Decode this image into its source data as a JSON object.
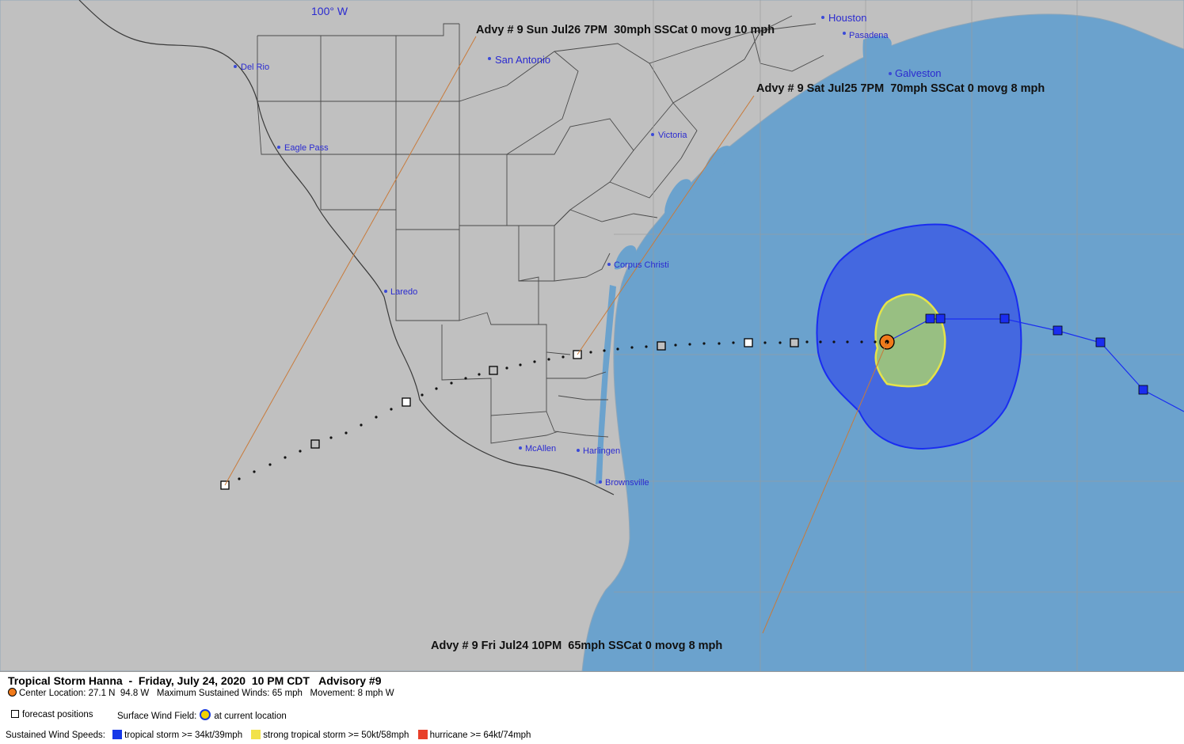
{
  "map": {
    "longitude_label": "100° W",
    "cities": [
      {
        "name": "Houston"
      },
      {
        "name": "Pasadena"
      },
      {
        "name": "San Antonio"
      },
      {
        "name": "Del Rio"
      },
      {
        "name": "Galveston"
      },
      {
        "name": "Eagle Pass"
      },
      {
        "name": "Victoria"
      },
      {
        "name": "Corpus Christi"
      },
      {
        "name": "Laredo"
      },
      {
        "name": "McAllen"
      },
      {
        "name": "Harlingen"
      },
      {
        "name": "Brownsville"
      }
    ],
    "advisory_labels": [
      {
        "text": "Advy # 9 Sun Jul26 7PM  30mph SSCat 0 movg 10 mph"
      },
      {
        "text": "Advy # 9 Sat Jul25 7PM  70mph SSCat 0 movg 8 mph"
      },
      {
        "text": "Advy # 9 Fri Jul24 10PM  65mph SSCat 0 movg 8 mph"
      }
    ]
  },
  "legend": {
    "title": "Tropical Storm Hanna  -  Friday, July 24, 2020  10 PM CDT   Advisory #9",
    "center_info": "Center Location: 27.1 N  94.8 W   Maximum Sustained Winds: 65 mph   Movement: 8 mph W",
    "forecast_positions": "forecast positions",
    "surface_wind_field": "Surface Wind Field:",
    "at_current_location": "at current location",
    "sustained_wind_speeds": "Sustained Wind Speeds:",
    "wind_categories": [
      {
        "label": "tropical storm >= 34kt/39mph",
        "color": "#1638e8"
      },
      {
        "label": "strong tropical storm >= 50kt/58mph",
        "color": "#f2e24a"
      },
      {
        "label": "hurricane >= 64kt/74mph",
        "color": "#e8402a"
      }
    ]
  },
  "colors": {
    "land": "#c0c0c0",
    "water": "#6ba2cd",
    "ts_wind_field": "#4468e0",
    "ts_wind_outline": "#1a2df0",
    "strong_ts_fill": "#98bf82",
    "strong_ts_outline": "#e5e34a",
    "storm_center": "#f07a1a"
  }
}
